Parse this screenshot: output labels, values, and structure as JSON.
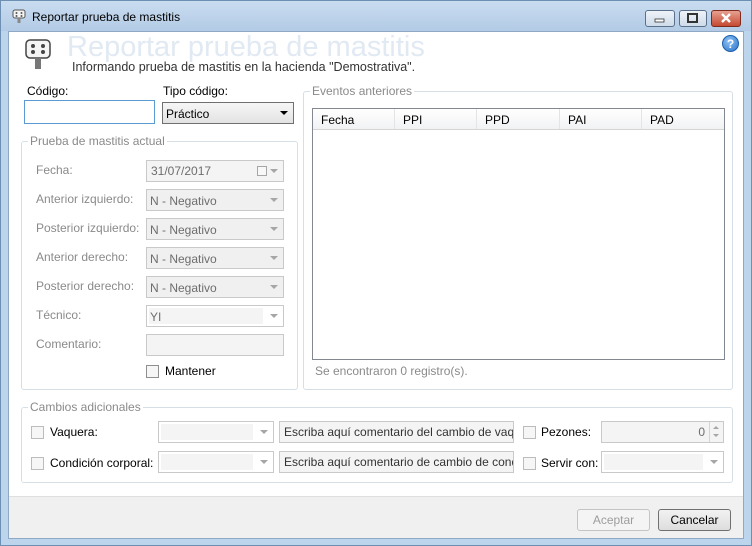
{
  "window": {
    "title": "Reportar prueba de mastitis"
  },
  "header": {
    "title": "Reportar prueba de mastitis",
    "subtitle": "Informando prueba de mastitis en la hacienda \"Demostrativa\".",
    "help": "?"
  },
  "codigo": {
    "label": "Código:",
    "value": ""
  },
  "tipo_codigo": {
    "label": "Tipo código:",
    "value": "Práctico"
  },
  "prueba": {
    "title": "Prueba de mastitis actual",
    "fecha_label": "Fecha:",
    "fecha_value": "31/07/2017",
    "ant_izq_label": "Anterior izquierdo:",
    "ant_izq_value": "N - Negativo",
    "post_izq_label": "Posterior izquierdo:",
    "post_izq_value": "N - Negativo",
    "ant_der_label": "Anterior derecho:",
    "ant_der_value": "N - Negativo",
    "post_der_label": "Posterior derecho:",
    "post_der_value": "N - Negativo",
    "tecnico_label": "Técnico:",
    "tecnico_value": "YI",
    "comentario_label": "Comentario:",
    "comentario_value": "",
    "mantener_label": "Mantener"
  },
  "eventos": {
    "title": "Eventos anteriores",
    "columns": [
      "Fecha",
      "PPI",
      "PPD",
      "PAI",
      "PAD"
    ],
    "status": "Se encontraron 0 registro(s)."
  },
  "cambios": {
    "title": "Cambios adicionales",
    "vaquera_label": "Vaquera:",
    "vaquera_comment": "Escriba aquí comentario del cambio de vaque",
    "condicion_label": "Condición corporal:",
    "condicion_comment": "Escriba aquí comentario de cambio de condi",
    "pezones_label": "Pezones:",
    "pezones_value": "0",
    "servir_label": "Servir con:"
  },
  "footer": {
    "accept": "Aceptar",
    "cancel": "Cancelar"
  },
  "colors": {
    "titlebar": "#bcd4ec",
    "close": "#c44a31",
    "accent": "#2872c9"
  }
}
